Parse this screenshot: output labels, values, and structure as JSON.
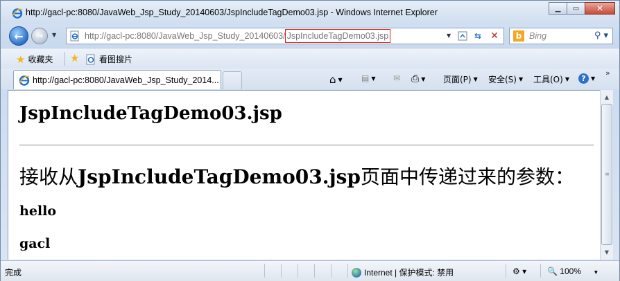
{
  "window": {
    "title": "http://gacl-pc:8080/JavaWeb_Jsp_Study_20140603/JspIncludeTagDemo03.jsp - Windows Internet Explorer",
    "minimize_glyph": "▁",
    "maximize_glyph": "▭",
    "close_glyph": "✕"
  },
  "address_bar": {
    "url_prefix": "http://gacl-pc:8080/JavaWeb_Jsp_Study_20140603/",
    "url_highlight": "JspIncludeTagDemo03.jsp",
    "highlight_color": "#d8221d"
  },
  "search": {
    "engine_logo": "b",
    "placeholder": "Bing"
  },
  "favorites_bar": {
    "favorites_label": "收藏夹",
    "suggested_site_label": "看图搜片"
  },
  "tab": {
    "label": "http://gacl-pc:8080/JavaWeb_Jsp_Study_2014..."
  },
  "command_bar": {
    "page_label": "页面(P)",
    "safety_label": "安全(S)",
    "tools_label": "工具(O)",
    "help_glyph": "?",
    "overflow_glyph": "»"
  },
  "page": {
    "title": "JspIncludeTagDemo03.jsp",
    "heading_prefix": "接收从",
    "heading_page": "JspIncludeTagDemo03.jsp",
    "heading_suffix": "页面中传递过来的参数：",
    "params": [
      "hello",
      "gacl"
    ]
  },
  "status_bar": {
    "status_text": "完成",
    "zone_label": "Internet | 保护模式: 禁用",
    "zoom": "100%"
  },
  "colors": {
    "ie_blue": "#2f6fc6",
    "close_red": "#c74a36"
  }
}
